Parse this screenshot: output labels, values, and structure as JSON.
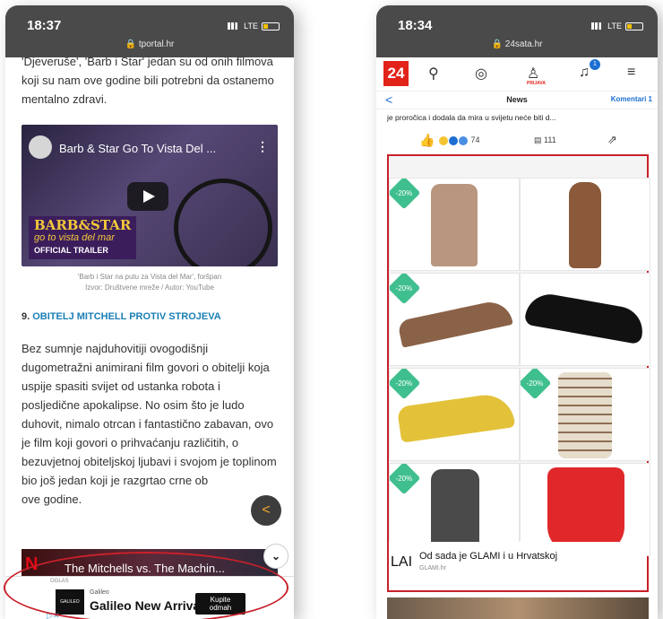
{
  "left": {
    "status": {
      "time": "18:37",
      "network": "LTE",
      "url": "tportal.hr"
    },
    "para_top": "'Djeveruše', 'Barb i Star' jedan su od onih filmova koji su nam ove godine bili potrebni da ostanemo mentalno zdravi.",
    "video": {
      "title": "Barb & Star Go To Vista Del ...",
      "logo_line1": "BARB",
      "logo_amp": "&",
      "logo_line1b": "STAR",
      "logo_line2": "go to vista del mar",
      "logo_line3": "OFFICIAL TRAILER"
    },
    "caption_line1": "'Barb i Star na putu za Vista del Mar', foršpan",
    "caption_line2": "Izvor: Društvene mreže / Autor: YouTube",
    "heading_number": "9.",
    "heading_link": "OBITELJ MITCHELL PROTIV STROJEVA",
    "para_main": "Bez sumnje najduhovitiji ovogodišnji dugometražni animirani film govori o obitelji koja uspije spasiti svijet od ustanka robota i posljedične apokalipse. No osim što je ludo duhovit, nimalo otrcan i fantastično zabavan, ovo je film koji govori o prihvaćanju različitih, o bezuvjetnoj obiteljskoj ljubavi i svojom je toplinom bio još jedan koji je razgrtao crne ob",
    "para_main_end": "ove godine.",
    "video2": {
      "n": "N",
      "title": "The Mitchells vs. The Machin..."
    },
    "ad": {
      "oglas": "OGLAS",
      "brand_small": "Galileo",
      "logo_text": "GALILEO",
      "title": "Galileo New Arrivals",
      "cta_line1": "Kupite",
      "cta_line2": "odmah"
    }
  },
  "right": {
    "status": {
      "time": "18:34",
      "network": "LTE",
      "url": "24sata.hr"
    },
    "logo": "24",
    "prijava": "PRIJAVA",
    "notif_count": "1",
    "subnav": {
      "back": "<",
      "title": "News",
      "comments": "Komentari 1"
    },
    "snippet": "je proročica i dodala da mira u svijetu neće biti d...",
    "reactions": {
      "count": "74",
      "comments": "111"
    },
    "ad": {
      "discounts": [
        "-20%",
        "-20%",
        "-20%",
        "-20%",
        "-20%"
      ],
      "info": "ⓘ ✕",
      "footer_prefix": "LAI",
      "footer_title": "Od sada je GLAMI i u Hrvatskoj",
      "footer_source": "GLAMI.hr"
    }
  }
}
